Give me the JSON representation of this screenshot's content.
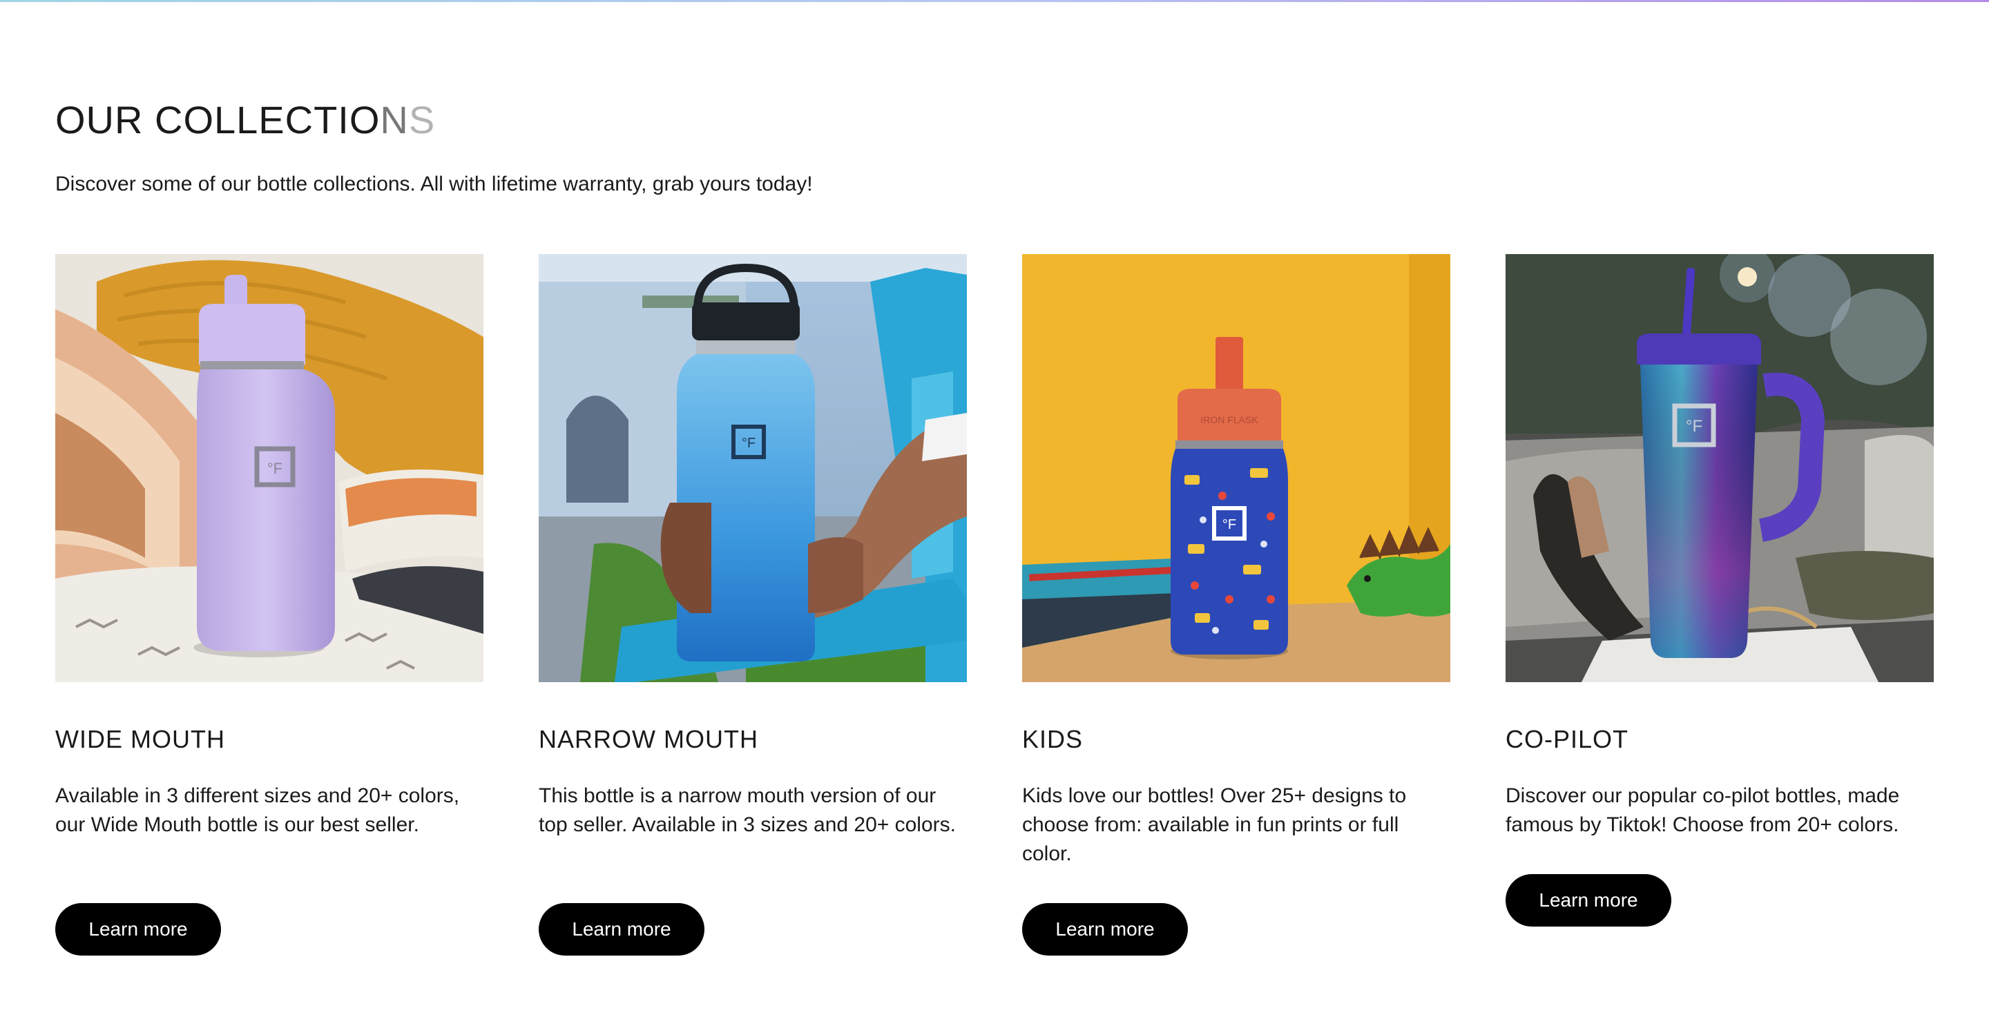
{
  "section": {
    "title_main": "OUR COLLECTIO",
    "title_fade_1": "N",
    "title_fade_2": "S",
    "subtitle": "Discover some of our bottle collections. All with lifetime warranty, grab yours today!"
  },
  "colors": {
    "accent_gradient": [
      "#9fd4e6",
      "#b58be8"
    ],
    "button_background": "#000000",
    "button_text": "#ffffff"
  },
  "collections": [
    {
      "title": "WIDE MOUTH",
      "description": "Available in 3 different sizes and 20+ colors, our Wide Mouth bottle is our best seller.",
      "button_label": "Learn more",
      "image_subject": "lavender-wide-mouth-bottle"
    },
    {
      "title": "NARROW MOUTH",
      "description": "This bottle is a narrow mouth version of our top seller. Available in 3 sizes and 20+ colors.",
      "button_label": "Learn more",
      "image_subject": "blue-narrow-mouth-bottle"
    },
    {
      "title": "KIDS",
      "description": "Kids love our bottles! Over 25+ designs to choose from: available in fun prints or full color.",
      "button_label": "Learn more",
      "image_subject": "kids-printed-bottle"
    },
    {
      "title": "CO-PILOT",
      "description": "Discover our popular co-pilot bottles, made famous by Tiktok! Choose from 20+ colors.",
      "button_label": "Learn more",
      "image_subject": "iridescent-co-pilot-tumbler"
    }
  ],
  "logo_mark": "°F",
  "bottle_brand_print": "IRON FLASK"
}
